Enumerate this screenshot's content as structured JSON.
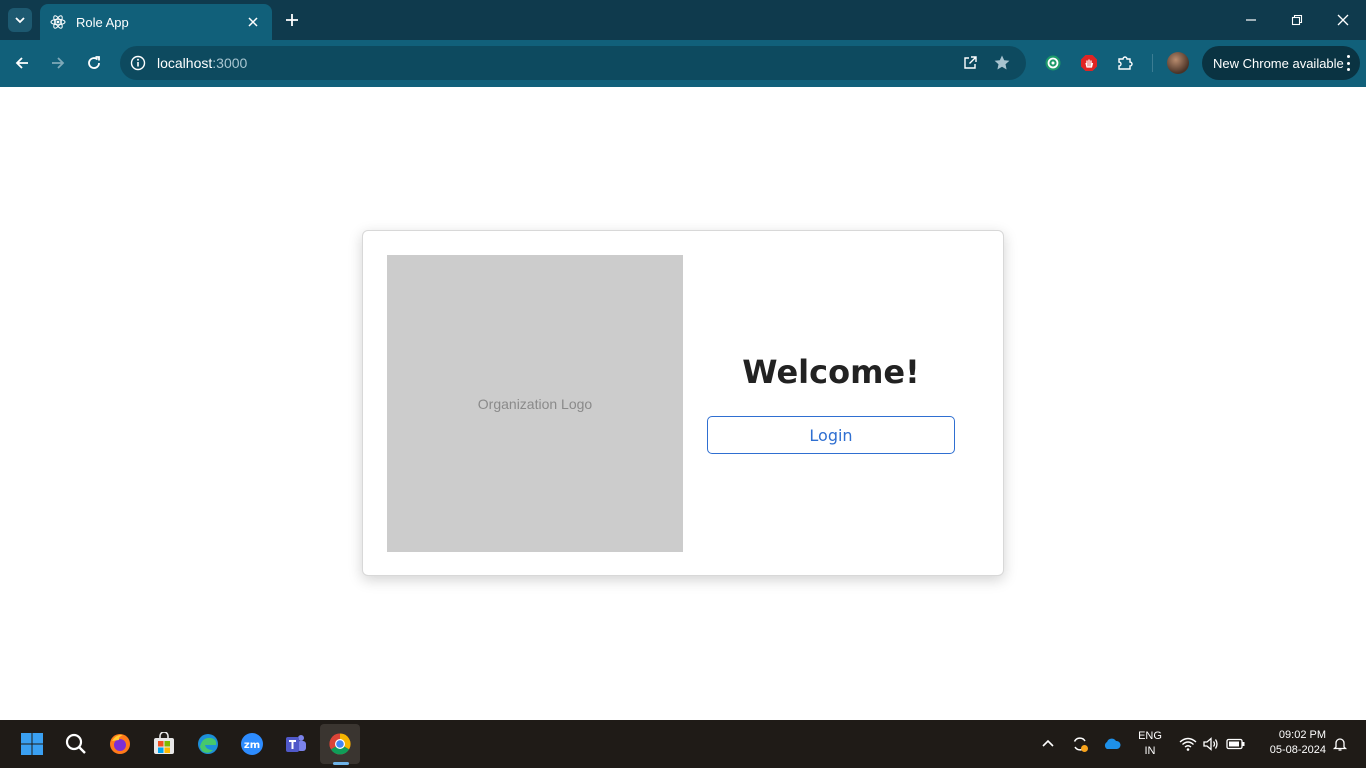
{
  "browser": {
    "tab": {
      "title": "Role App"
    },
    "address": {
      "host": "localhost",
      "port": ":3000"
    },
    "update_label": "New Chrome available"
  },
  "page": {
    "logo_placeholder": "Organization Logo",
    "welcome": "Welcome!",
    "login_label": "Login"
  },
  "taskbar": {
    "language_line1": "ENG",
    "language_line2": "IN",
    "time": "09:02 PM",
    "date": "05-08-2024"
  }
}
